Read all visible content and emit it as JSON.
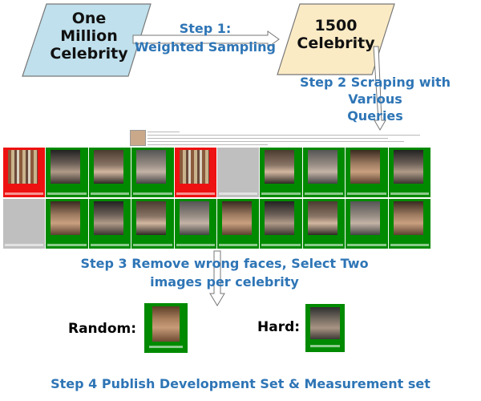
{
  "nodes": {
    "one_million": "One\nMillion\nCelebrity",
    "celebrity_1500": "1500\nCelebrity"
  },
  "steps": {
    "step1": "Step 1:\nWeighted Sampling",
    "step2": "Step 2 Scraping with Various\nQueries",
    "step3": "Step 3 Remove wrong faces, Select Two\nimages per celebrity",
    "step4": "Step 4 Publish Development Set & Measurement set"
  },
  "selection": {
    "random_label": "Random:",
    "hard_label": "Hard:"
  },
  "colors": {
    "node_blue": "#BFE0EC",
    "node_cream": "#FBEBC5",
    "step_text": "#2E75B6",
    "accept_green": "#008A00",
    "reject_red": "#EE1111",
    "unknown_gray": "#BFBFBF"
  },
  "grid": {
    "rows": [
      [
        "red",
        "green",
        "green",
        "green",
        "red",
        "gray",
        "green",
        "green",
        "green",
        "green"
      ],
      [
        "gray",
        "green",
        "green",
        "green",
        "green",
        "green",
        "green",
        "green",
        "green",
        "green"
      ]
    ]
  }
}
